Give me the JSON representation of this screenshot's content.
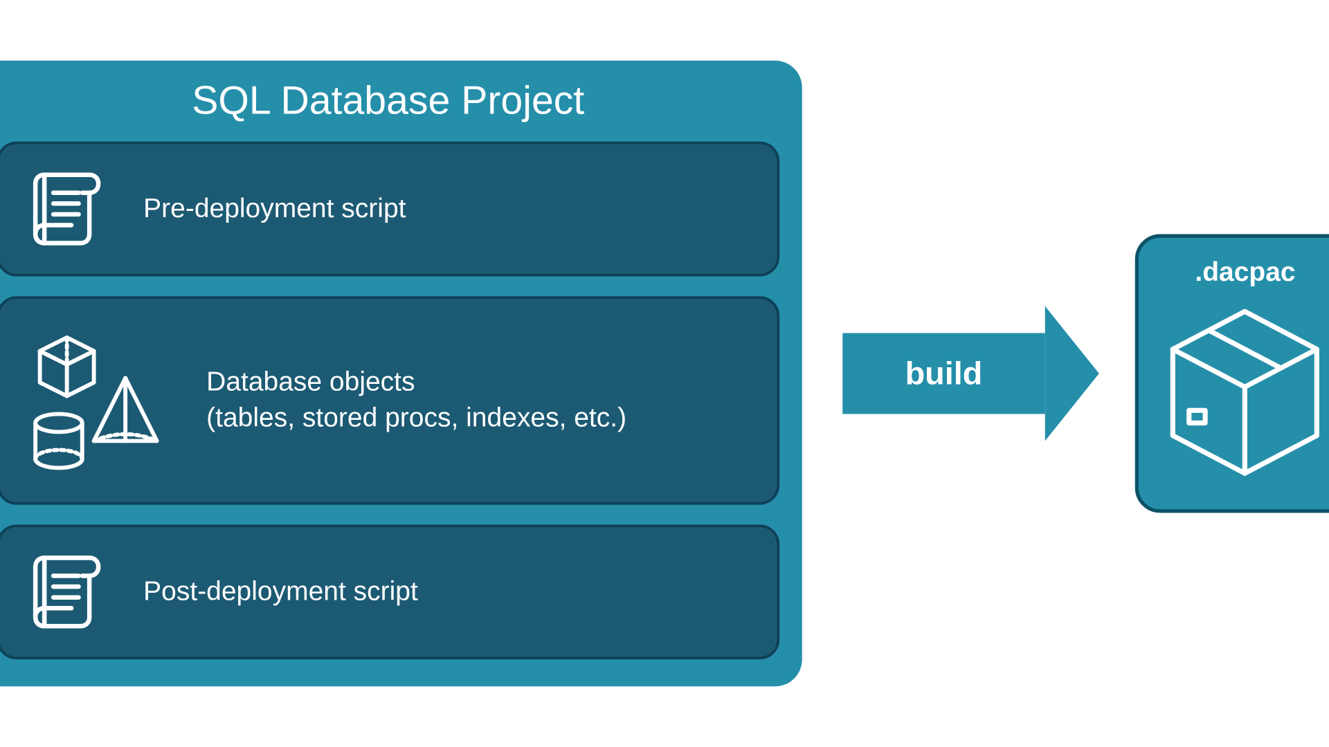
{
  "project": {
    "title": "SQL Database Project",
    "pre_script_label": "Pre-deployment script",
    "db_objects_line1": "Database objects",
    "db_objects_line2": "(tables, stored procs, indexes, etc.)",
    "post_script_label": "Post-deployment script"
  },
  "arrow": {
    "label": "build"
  },
  "output": {
    "label": ".dacpac"
  },
  "colors": {
    "teal": "#258faa",
    "dark_teal": "#1c5a73",
    "border_dark": "#0d5268",
    "white": "#ffffff"
  }
}
